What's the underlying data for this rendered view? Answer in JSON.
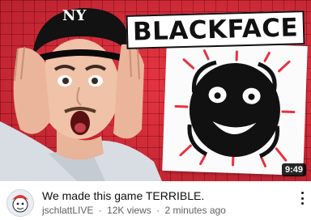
{
  "thumbnail": {
    "overlay_text": "BLACKFACE",
    "duration": "9:49",
    "hat_text": "NY",
    "colors": {
      "background": "#e8323f",
      "grid": "#7a0a14",
      "card": "#fbfbfb",
      "hoodie": "#d8dde3"
    }
  },
  "video": {
    "title": "We made this game TERRIBLE.",
    "channel": "jschlattLIVE",
    "views": "12K views",
    "separator": "·",
    "age": "2 minutes ago"
  },
  "icons": {
    "more": "more-vertical-icon",
    "avatar": "channel-avatar"
  }
}
